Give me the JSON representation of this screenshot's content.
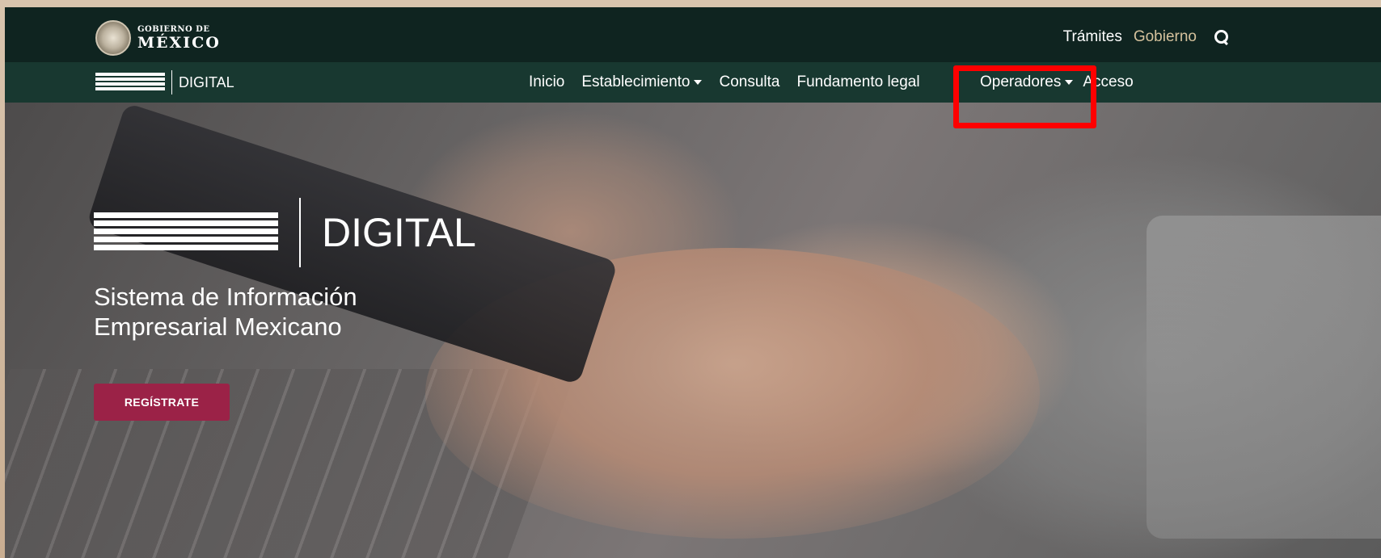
{
  "gov_bar": {
    "logo_small": "GOBIERNO DE",
    "logo_big": "MÉXICO",
    "links": [
      {
        "label": "Trámites"
      },
      {
        "label": "Gobierno"
      }
    ],
    "search_icon": "search-icon"
  },
  "nav": {
    "brand_text": "DIGITAL",
    "items": [
      {
        "label": "Inicio",
        "dropdown": false
      },
      {
        "label": "Establecimiento",
        "dropdown": true
      },
      {
        "label": "Consulta",
        "dropdown": false
      },
      {
        "label": "Fundamento legal",
        "dropdown": false
      },
      {
        "label": "Operadores",
        "dropdown": true
      },
      {
        "label": "Acceso",
        "dropdown": false
      }
    ],
    "highlight_color": "#ff0000"
  },
  "hero": {
    "brand_text": "DIGITAL",
    "tagline_line1": "Sistema de Información",
    "tagline_line2": "Empresarial Mexicano",
    "cta_label": "REGÍSTRATE",
    "cta_color": "#9b2247"
  },
  "colors": {
    "gov_bar": "#0f2420",
    "nav_bar": "#183830",
    "gold_link": "#d4c19c"
  }
}
